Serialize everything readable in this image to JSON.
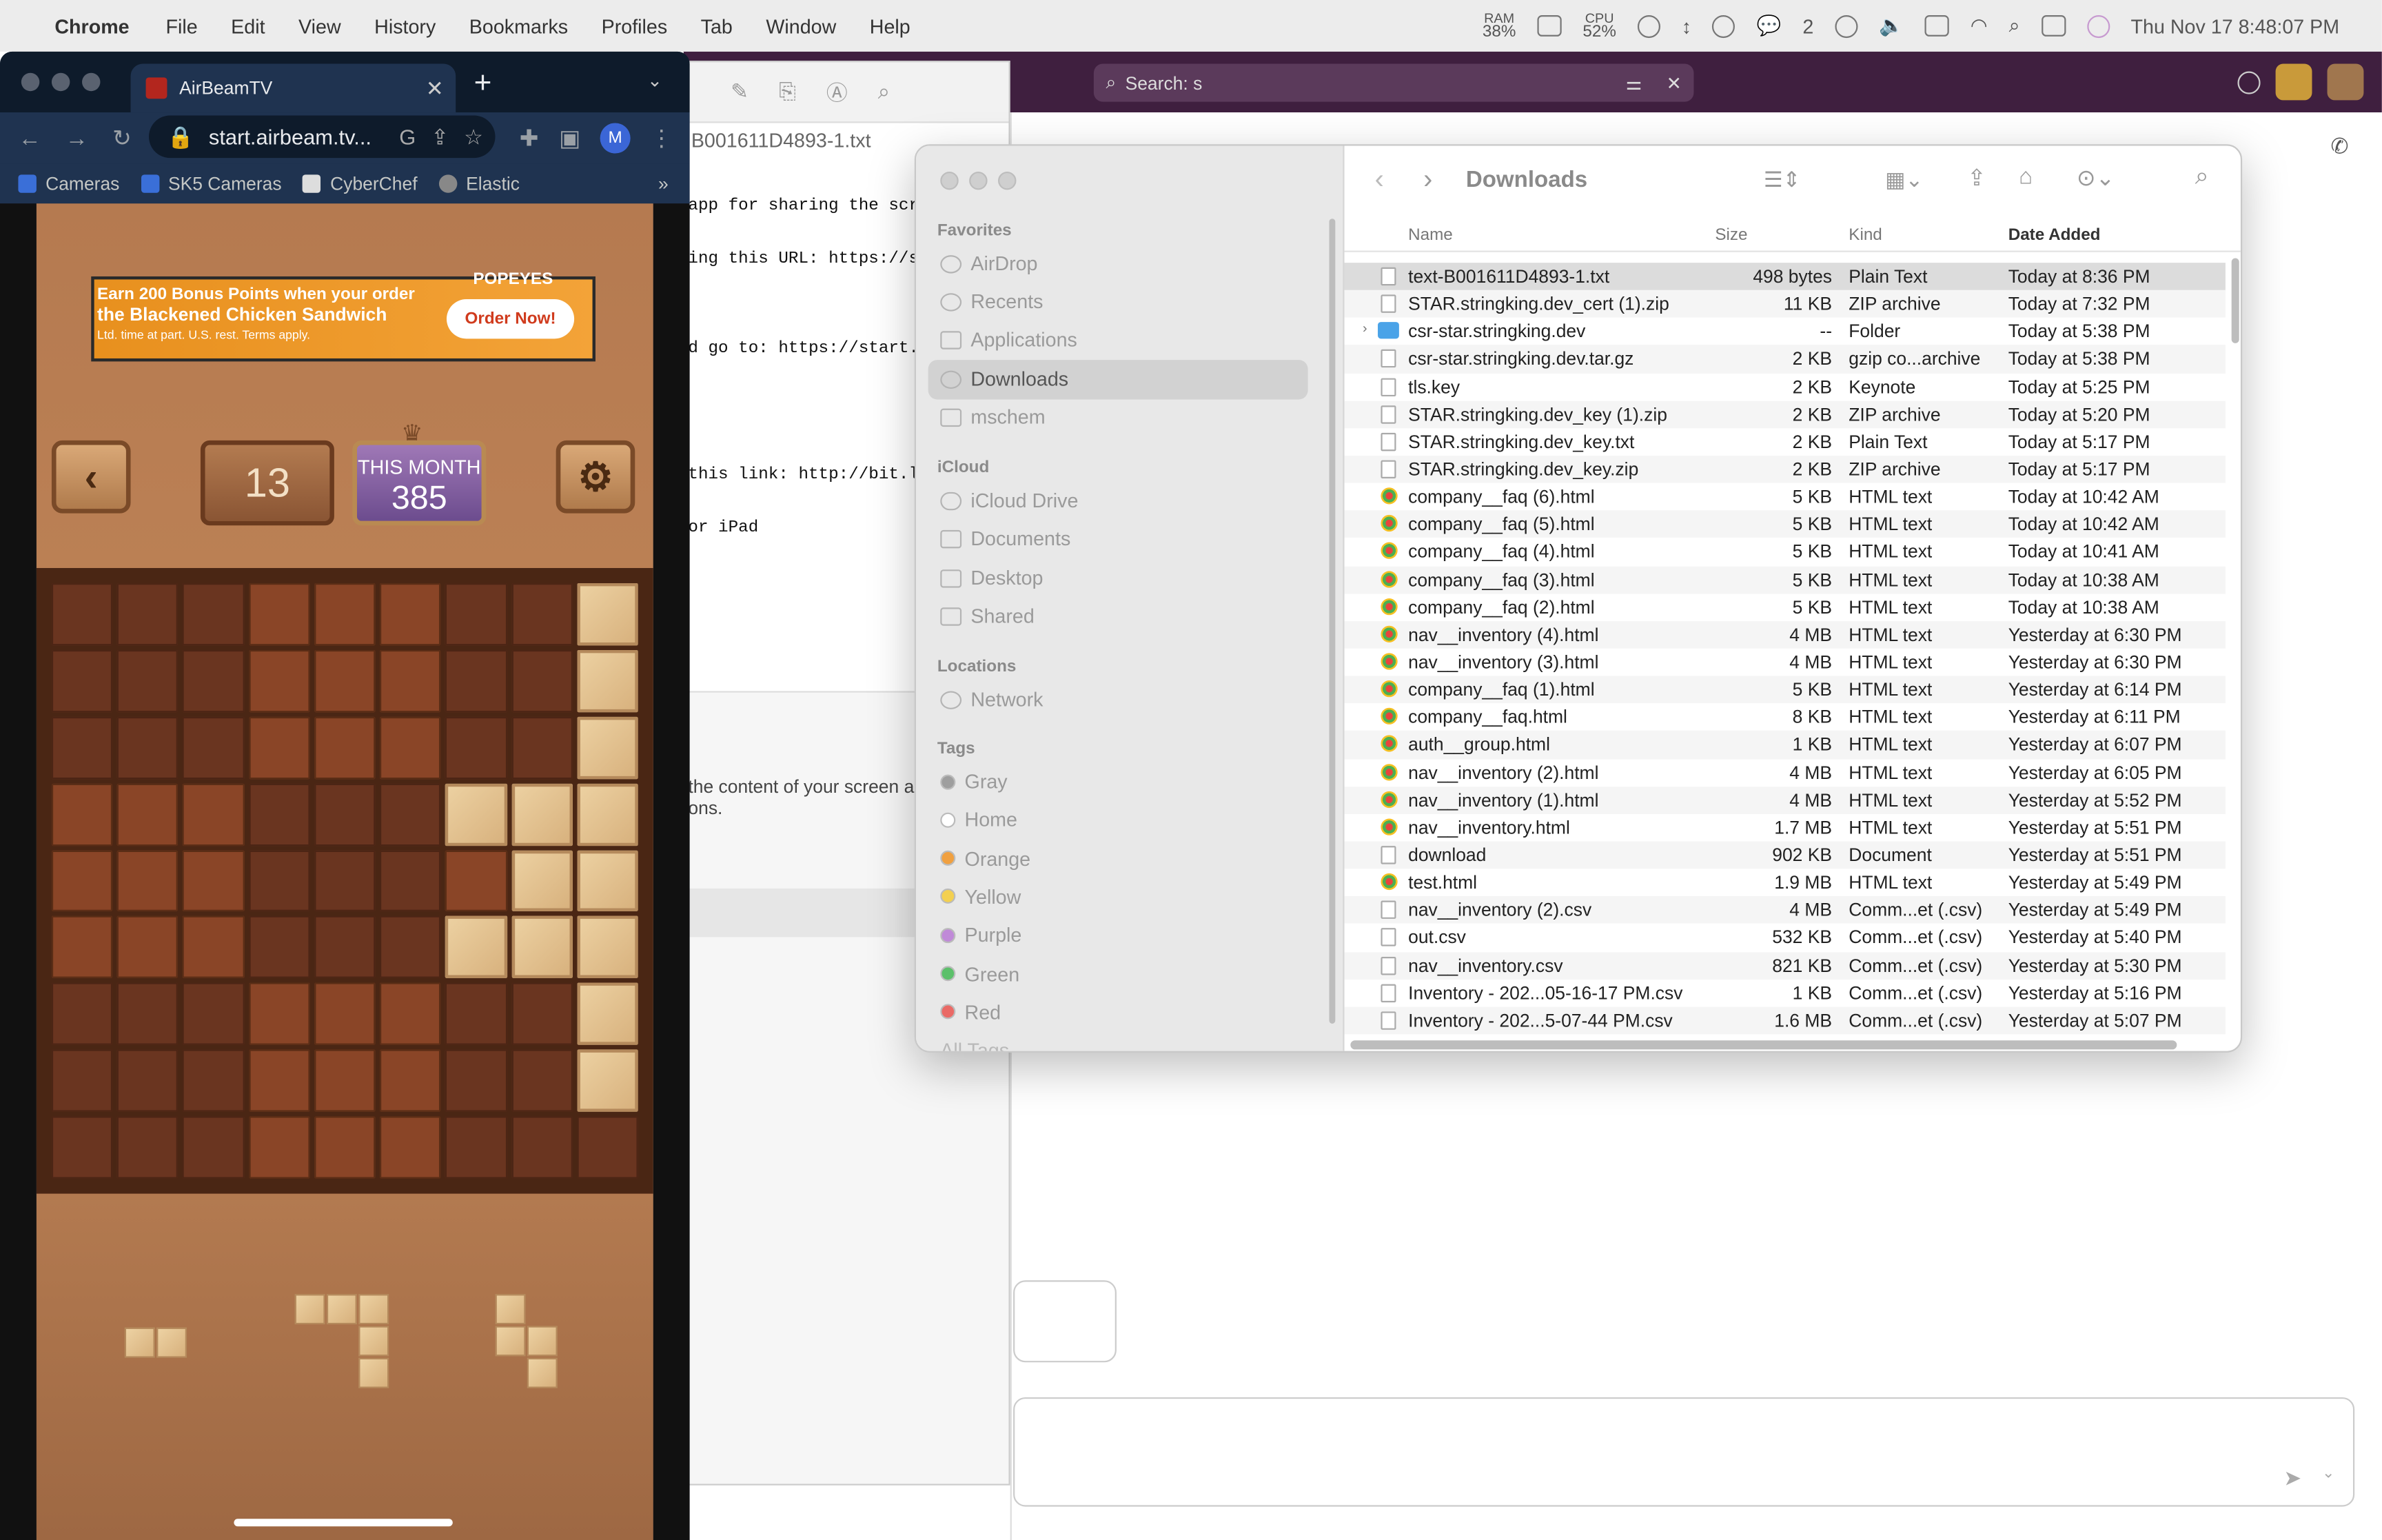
{
  "menubar": {
    "apple": "",
    "app": "Chrome",
    "items": [
      "File",
      "Edit",
      "View",
      "History",
      "Bookmarks",
      "Profiles",
      "Tab",
      "Window",
      "Help"
    ],
    "ram_label": "RAM",
    "ram_value": "38%",
    "cpu_label": "CPU",
    "cpu_value": "52%",
    "wechat_count": "2",
    "clock": "Thu Nov 17  8:48:07 PM"
  },
  "slack": {
    "search": "Search: s"
  },
  "textedit": {
    "title": "B001611D4893-1.txt",
    "lines": [
      "app for sharing the scree",
      "ing this URL: https://sta",
      "",
      "d go to: https://start.ai",
      "",
      "",
      "this link: http://bit.ly/",
      "or iPad"
    ],
    "text2": "the content of your screen a\nons."
  },
  "browser": {
    "tab_title": "AirBeamTV",
    "url": "start.airbeam.tv...",
    "profile": "M",
    "bookmarks": [
      "Cameras",
      "SK5 Cameras",
      "CyberChef",
      "Elastic"
    ],
    "more": "»"
  },
  "game": {
    "ad_line1": "Earn 200 Bonus Points when your order",
    "ad_line2": "the Blackened Chicken Sandwich",
    "ad_line3": "Ltd. time at part. U.S. rest. Terms apply.",
    "ad_brand": "POPEYES",
    "ad_button": "Order Now!",
    "score": "13",
    "month_label": "THIS MONTH",
    "month_value": "385",
    "board_rows": [
      "000000001",
      "000000001",
      "000000001",
      "000000111",
      "000000011",
      "000000111",
      "000000001",
      "000000001",
      "000000000"
    ]
  },
  "finder": {
    "title": "Downloads",
    "sidebar": {
      "favorites_header": "Favorites",
      "favorites": [
        "AirDrop",
        "Recents",
        "Applications",
        "Downloads",
        "mschem"
      ],
      "icloud_header": "iCloud",
      "icloud": [
        "iCloud Drive",
        "Documents",
        "Desktop",
        "Shared"
      ],
      "locations_header": "Locations",
      "locations": [
        "Network"
      ],
      "tags_header": "Tags",
      "tags": [
        {
          "name": "Gray",
          "color": "#9e9e9e"
        },
        {
          "name": "Home",
          "color": "#ffffff"
        },
        {
          "name": "Orange",
          "color": "#f0a040"
        },
        {
          "name": "Yellow",
          "color": "#f3d050"
        },
        {
          "name": "Purple",
          "color": "#c08ad8"
        },
        {
          "name": "Green",
          "color": "#5cc06a"
        },
        {
          "name": "Red",
          "color": "#ea6a66"
        }
      ],
      "all_tags": "All Tags"
    },
    "columns": {
      "name": "Name",
      "size": "Size",
      "kind": "Kind",
      "date": "Date Added"
    },
    "rows": [
      {
        "name": "text-B001611D4893-1.txt",
        "size": "498 bytes",
        "kind": "Plain Text",
        "date": "Today at 8:36 PM",
        "icon": "txt"
      },
      {
        "name": "STAR.stringking.dev_cert (1).zip",
        "size": "11 KB",
        "kind": "ZIP archive",
        "date": "Today at 7:32 PM",
        "icon": "zip"
      },
      {
        "name": "csr-star.stringking.dev",
        "size": "--",
        "kind": "Folder",
        "date": "Today at 5:38 PM",
        "icon": "folder"
      },
      {
        "name": "csr-star.stringking.dev.tar.gz",
        "size": "2 KB",
        "kind": "gzip co...archive",
        "date": "Today at 5:38 PM",
        "icon": "zip"
      },
      {
        "name": "tls.key",
        "size": "2 KB",
        "kind": "Keynote",
        "date": "Today at 5:25 PM",
        "icon": "txt"
      },
      {
        "name": "STAR.stringking.dev_key (1).zip",
        "size": "2 KB",
        "kind": "ZIP archive",
        "date": "Today at 5:20 PM",
        "icon": "zip"
      },
      {
        "name": "STAR.stringking.dev_key.txt",
        "size": "2 KB",
        "kind": "Plain Text",
        "date": "Today at 5:17 PM",
        "icon": "txt"
      },
      {
        "name": "STAR.stringking.dev_key.zip",
        "size": "2 KB",
        "kind": "ZIP archive",
        "date": "Today at 5:17 PM",
        "icon": "zip"
      },
      {
        "name": "company__faq (6).html",
        "size": "5 KB",
        "kind": "HTML text",
        "date": "Today at 10:42 AM",
        "icon": "html"
      },
      {
        "name": "company__faq (5).html",
        "size": "5 KB",
        "kind": "HTML text",
        "date": "Today at 10:42 AM",
        "icon": "html"
      },
      {
        "name": "company__faq (4).html",
        "size": "5 KB",
        "kind": "HTML text",
        "date": "Today at 10:41 AM",
        "icon": "html"
      },
      {
        "name": "company__faq (3).html",
        "size": "5 KB",
        "kind": "HTML text",
        "date": "Today at 10:38 AM",
        "icon": "html"
      },
      {
        "name": "company__faq (2).html",
        "size": "5 KB",
        "kind": "HTML text",
        "date": "Today at 10:38 AM",
        "icon": "html"
      },
      {
        "name": "nav__inventory (4).html",
        "size": "4 MB",
        "kind": "HTML text",
        "date": "Yesterday at 6:30 PM",
        "icon": "html"
      },
      {
        "name": "nav__inventory (3).html",
        "size": "4 MB",
        "kind": "HTML text",
        "date": "Yesterday at 6:30 PM",
        "icon": "html"
      },
      {
        "name": "company__faq (1).html",
        "size": "5 KB",
        "kind": "HTML text",
        "date": "Yesterday at 6:14 PM",
        "icon": "html"
      },
      {
        "name": "company__faq.html",
        "size": "8 KB",
        "kind": "HTML text",
        "date": "Yesterday at 6:11 PM",
        "icon": "html"
      },
      {
        "name": "auth__group.html",
        "size": "1 KB",
        "kind": "HTML text",
        "date": "Yesterday at 6:07 PM",
        "icon": "html"
      },
      {
        "name": "nav__inventory (2).html",
        "size": "4 MB",
        "kind": "HTML text",
        "date": "Yesterday at 6:05 PM",
        "icon": "html"
      },
      {
        "name": "nav__inventory (1).html",
        "size": "4 MB",
        "kind": "HTML text",
        "date": "Yesterday at 5:52 PM",
        "icon": "html"
      },
      {
        "name": "nav__inventory.html",
        "size": "1.7 MB",
        "kind": "HTML text",
        "date": "Yesterday at 5:51 PM",
        "icon": "html"
      },
      {
        "name": "download",
        "size": "902 KB",
        "kind": "Document",
        "date": "Yesterday at 5:51 PM",
        "icon": "txt"
      },
      {
        "name": "test.html",
        "size": "1.9 MB",
        "kind": "HTML text",
        "date": "Yesterday at 5:49 PM",
        "icon": "html"
      },
      {
        "name": "nav__inventory (2).csv",
        "size": "4 MB",
        "kind": "Comm...et (.csv)",
        "date": "Yesterday at 5:49 PM",
        "icon": "txt"
      },
      {
        "name": "out.csv",
        "size": "532 KB",
        "kind": "Comm...et (.csv)",
        "date": "Yesterday at 5:40 PM",
        "icon": "txt"
      },
      {
        "name": "nav__inventory.csv",
        "size": "821 KB",
        "kind": "Comm...et (.csv)",
        "date": "Yesterday at 5:30 PM",
        "icon": "txt"
      },
      {
        "name": "Inventory - 202...05-16-17 PM.csv",
        "size": "1 KB",
        "kind": "Comm...et (.csv)",
        "date": "Yesterday at 5:16 PM",
        "icon": "txt"
      },
      {
        "name": "Inventory - 202...5-07-44 PM.csv",
        "size": "1.6 MB",
        "kind": "Comm...et (.csv)",
        "date": "Yesterday at 5:07 PM",
        "icon": "txt"
      }
    ]
  }
}
